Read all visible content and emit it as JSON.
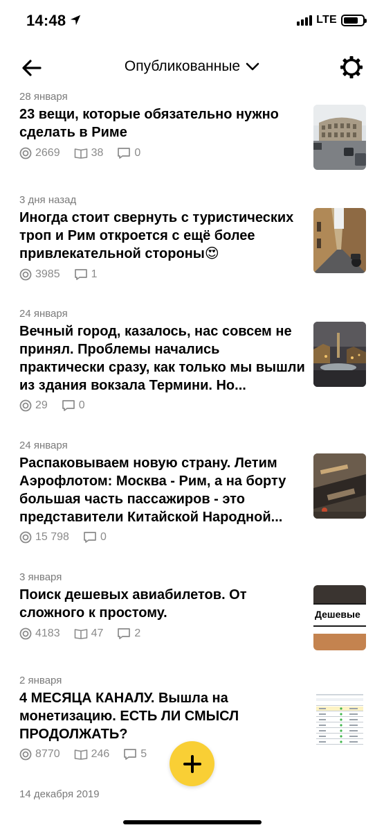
{
  "status": {
    "time": "14:48",
    "network": "LTE"
  },
  "nav": {
    "title": "Опубликованные"
  },
  "articles": [
    {
      "date": "28 января",
      "title": "23 вещи, которые обязательно нужно сделать в Риме",
      "views": "2669",
      "reads": "38",
      "comments": "0",
      "thumb": "colosseum-photo"
    },
    {
      "date": "3 дня назад",
      "title": "Иногда стоит свернуть с туристических троп и Рим откроется с ещё более привлекательной стороны😍",
      "views": "3985",
      "comments": "1",
      "thumb": "rome-street-photo"
    },
    {
      "date": "24 января",
      "title": "Вечный город, казалось, нас совсем не принял. Проблемы начались практически сразу, как только мы вышли из здания вокзала Термини. Но...",
      "views": "29",
      "comments": "0",
      "thumb": "night-fountain-photo"
    },
    {
      "date": "24 января",
      "title": "Распаковываем новую страну. Летим Аэрофлотом: Москва - Рим, а на борту большая часть пассажиров - это представители Китайской Народной...",
      "views": "15 798",
      "comments": "0",
      "thumb": "airplane-window-photo"
    },
    {
      "date": "3 января",
      "title": "Поиск дешевых авиабилетов. От сложного к простому.",
      "views": "4183",
      "reads": "47",
      "comments": "2",
      "thumb": "cheap-flights-banner",
      "thumb_text": "Дешевые"
    },
    {
      "date": "2 января",
      "title": "4 МЕСЯЦА КАНАЛУ. Вышла на монетизацию. ЕСТЬ ЛИ СМЫСЛ ПРОДОЛЖАТЬ?",
      "views": "8770",
      "reads": "246",
      "comments": "5",
      "thumb": "stats-table-screenshot"
    },
    {
      "date": "14 декабря 2019"
    }
  ],
  "colors": {
    "accent": "#f9cf35",
    "meta": "#8a8a8a"
  }
}
